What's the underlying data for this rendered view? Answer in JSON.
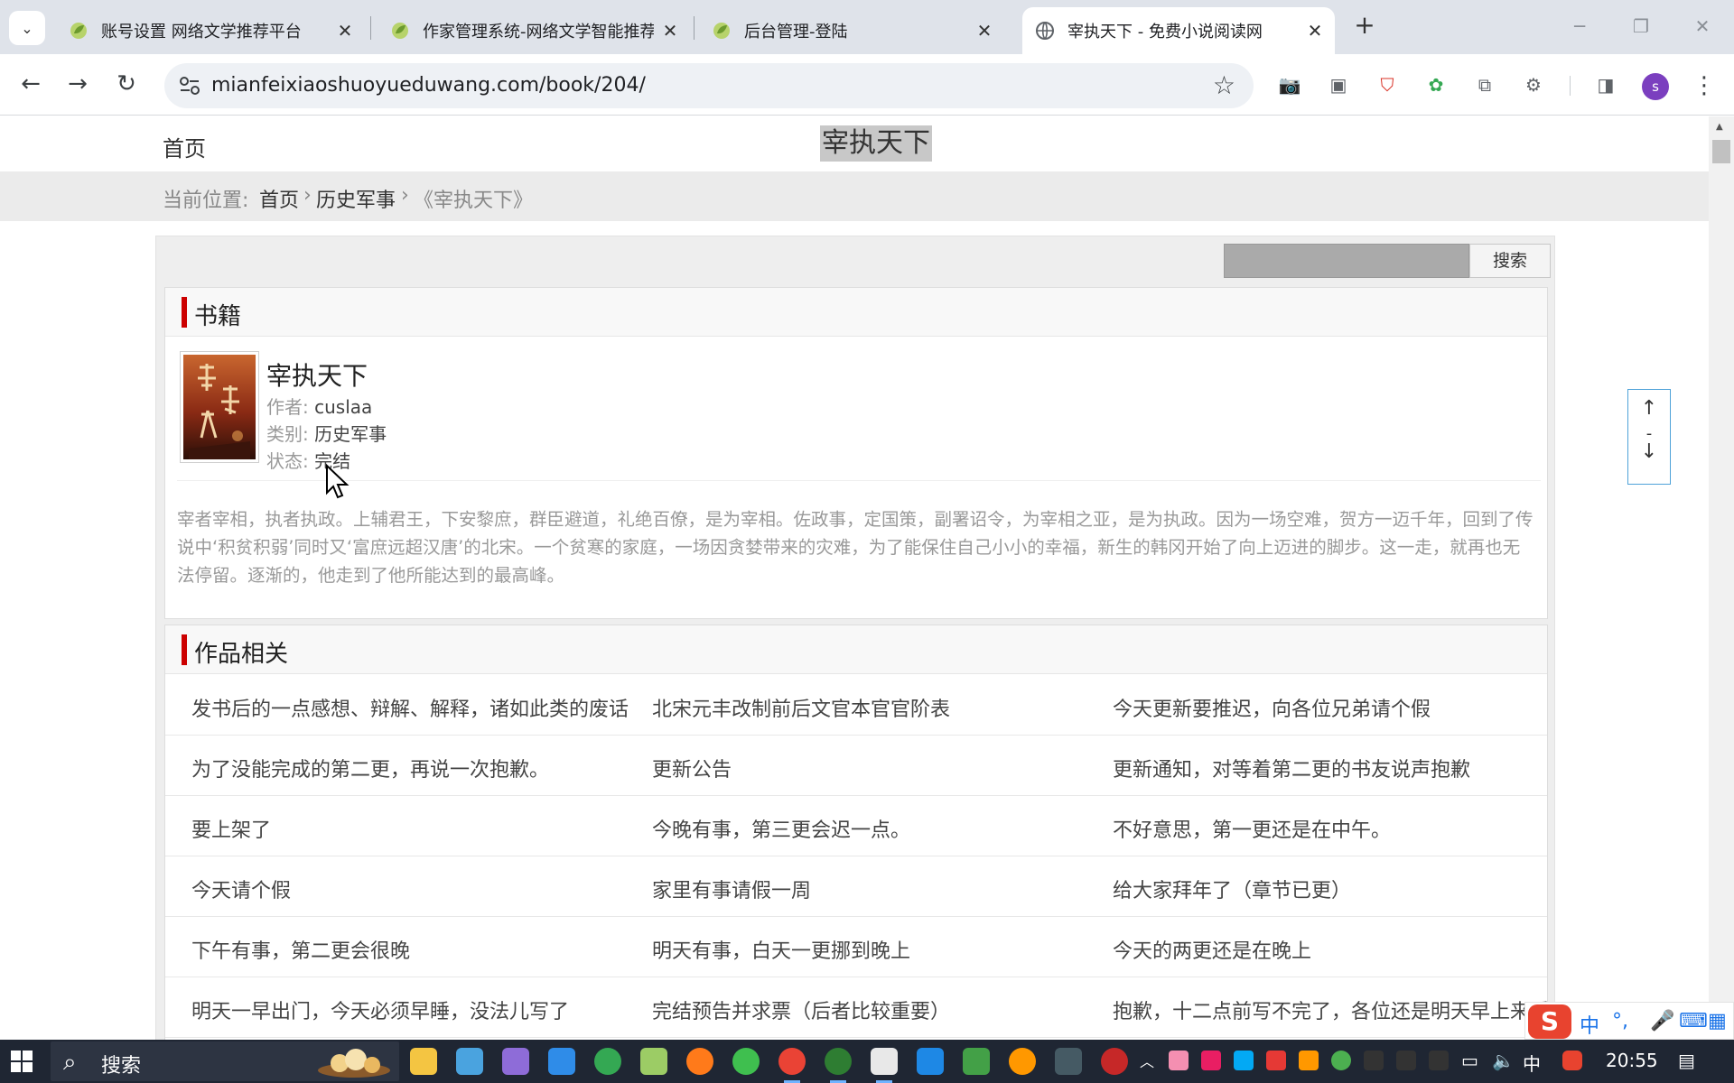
{
  "browser": {
    "tabs": [
      {
        "title": "账号设置 网络文学推荐平台",
        "active": false
      },
      {
        "title": "作家管理系统-网络文学智能推荐",
        "active": false
      },
      {
        "title": "后台管理-登陆",
        "active": false
      },
      {
        "title": "宰执天下 - 免费小说阅读网",
        "active": true
      }
    ],
    "url": "mianfeixiaoshuoyueduwang.com/book/204/",
    "profile_initial": "s",
    "colors": {
      "tab_strip": "#dfe3ea",
      "omnibox": "#eef1f5",
      "profile": "#7b3fbf"
    }
  },
  "header": {
    "home": "首页",
    "title": "宰执天下"
  },
  "breadcrumb": {
    "prefix": "当前位置:",
    "home": "首页",
    "sep1": "›",
    "category": "历史军事",
    "sep2": "›",
    "current": "《宰执天下》"
  },
  "search": {
    "button_label": "搜索",
    "value": ""
  },
  "book_section": {
    "heading": "书籍",
    "title": "宰执天下",
    "author_label": "作者:",
    "author": "cuslaa",
    "category_label": "类别:",
    "category": "历史军事",
    "status_label": "状态:",
    "status": "完结",
    "description": "宰者宰相，执者执政。上辅君王，下安黎庶，群臣避道，礼绝百僚，是为宰相。佐政事，定国策，副署诏令，为宰相之亚，是为执政。因为一场空难，贺方一迈千年，回到了传说中‘积贫积弱’同时又‘富庶远超汉唐’的北宋。一个贫寒的家庭，一场因贪婪带来的灾难，为了能保住自己小小的幸福，新生的韩冈开始了向上迈进的脚步。这一走，就再也无法停留。逐渐的，他走到了他所能达到的最高峰。"
  },
  "works_section": {
    "heading": "作品相关",
    "rows": [
      [
        "发书后的一点感想、辩解、解释，诸如此类的废话",
        "北宋元丰改制前后文官本官官阶表",
        "今天更新要推迟，向各位兄弟请个假"
      ],
      [
        "为了没能完成的第二更，再说一次抱歉。",
        "更新公告",
        "更新通知，对等着第二更的书友说声抱歉"
      ],
      [
        "要上架了",
        "今晚有事，第三更会迟一点。",
        "不好意思，第一更还是在中午。"
      ],
      [
        "今天请个假",
        "家里有事请假一周",
        "给大家拜年了（章节已更）"
      ],
      [
        "下午有事，第二更会很晚",
        "明天有事，白天一更挪到晚上",
        "今天的两更还是在晚上"
      ],
      [
        "明天一早出门，今天必须早睡，没法儿写了",
        "完结预告并求票（后者比较重要）",
        "抱歉，十二点前写不完了，各位还是明天早上来看"
      ]
    ]
  },
  "scroll_widget": {
    "up": "↑",
    "mid": "-",
    "down": "↓"
  },
  "ime": {
    "logo": "S",
    "lang": "中",
    "punct": "°,"
  },
  "taskbar": {
    "search_placeholder": "搜索",
    "input_lang": "中",
    "time": "20:55"
  }
}
